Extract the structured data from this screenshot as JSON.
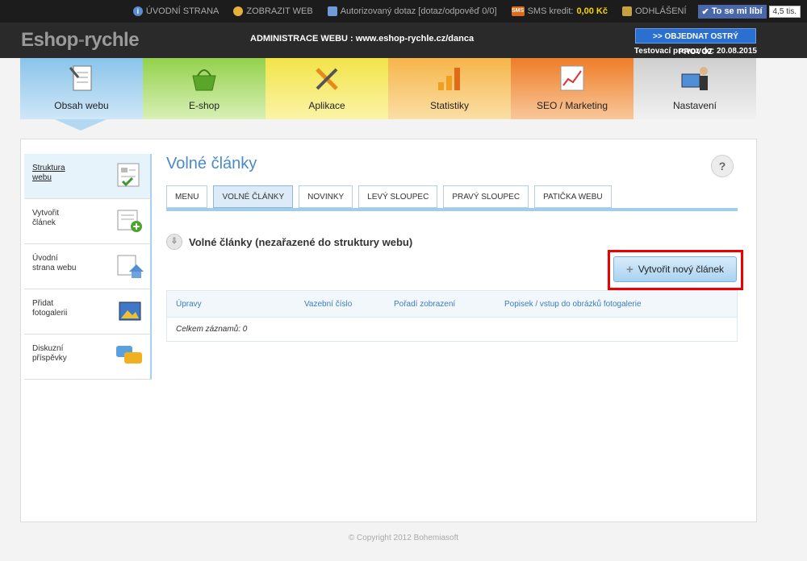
{
  "topbar": {
    "home": "ÚVODNÍ STRANA",
    "view_web": "ZOBRAZIT WEB",
    "query": "Autorizovaný dotaz [dotaz/odpověď 0/0]",
    "sms_badge": "SMS",
    "sms_label": "SMS kredit:",
    "sms_value": "0,00 Kč",
    "logout": "ODHLÁŠENÍ",
    "like_label": "To se mi líbí",
    "like_count": "4,5 tis."
  },
  "header": {
    "logo_a": "Eshop",
    "logo_dash": "-",
    "logo_b": "rychle",
    "admin_title": "ADMINISTRACE WEBU : www.eshop-rychle.cz/danca",
    "order_button": ">> OBJEDNAT OSTRÝ PROVOZ",
    "test_until": "Testovací provoz do: 20.08.2015"
  },
  "nav": {
    "tabs": [
      {
        "label": "Obsah webu"
      },
      {
        "label": "E-shop"
      },
      {
        "label": "Aplikace"
      },
      {
        "label": "Statistiky"
      },
      {
        "label": "SEO / Marketing"
      },
      {
        "label": "Nastavení"
      }
    ]
  },
  "sidebar": {
    "items": [
      {
        "line1": "Struktura",
        "line2": "webu"
      },
      {
        "line1": "Vytvořit",
        "line2": "článek"
      },
      {
        "line1": "Úvodní",
        "line2": "strana webu"
      },
      {
        "line1": "Přidat",
        "line2": "fotogalerii"
      },
      {
        "line1": "Diskuzní",
        "line2": "příspěvky"
      }
    ]
  },
  "main": {
    "title": "Volné články",
    "help": "?",
    "tabs": [
      {
        "label": "MENU"
      },
      {
        "label": "VOLNÉ ČLÁNKY"
      },
      {
        "label": "NOVINKY"
      },
      {
        "label": "LEVÝ SLOUPEC"
      },
      {
        "label": "PRAVÝ SLOUPEC"
      },
      {
        "label": "PATIČKA WEBU"
      }
    ],
    "section_title": "Volné články (nezařazené do struktury webu)",
    "new_button": "Vytvořit nový článek",
    "table": {
      "headers": [
        "Úpravy",
        "Vazební číslo",
        "Pořadí zobrazení",
        "Popisek / vstup do obrázků fotogalerie"
      ],
      "total": "Celkem záznamů: 0"
    }
  },
  "footer": "© Copyright 2012 Bohemiasoft"
}
